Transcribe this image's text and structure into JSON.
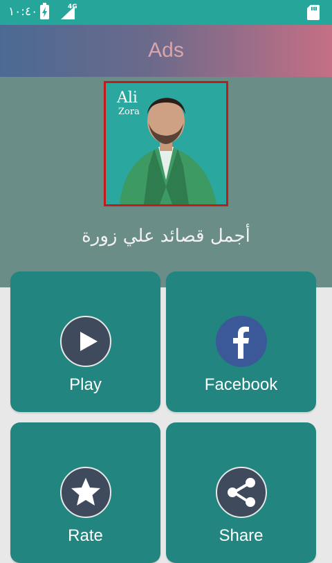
{
  "status": {
    "time": "١٠:٤٠",
    "network": "4G"
  },
  "header": {
    "title": "Ads"
  },
  "hero": {
    "photo_name_line1": "Ali",
    "photo_name_line2": "Zora",
    "subtitle": "أجمل قصائد علي زورة"
  },
  "cards": [
    {
      "label": "Play",
      "icon": "play-icon"
    },
    {
      "label": "Facebook",
      "icon": "facebook-icon"
    },
    {
      "label": "Rate",
      "icon": "star-icon"
    },
    {
      "label": "Share",
      "icon": "share-icon"
    }
  ],
  "colors": {
    "statusbar": "#26a69a",
    "card": "#22857f",
    "hero_bg": "#6b8d87",
    "header_gradient_start": "#4b6a93",
    "header_gradient_end": "#c56f84",
    "photo_border": "#c21b1b",
    "facebook": "#3b5998",
    "icon_dark": "#3f4b5d"
  }
}
